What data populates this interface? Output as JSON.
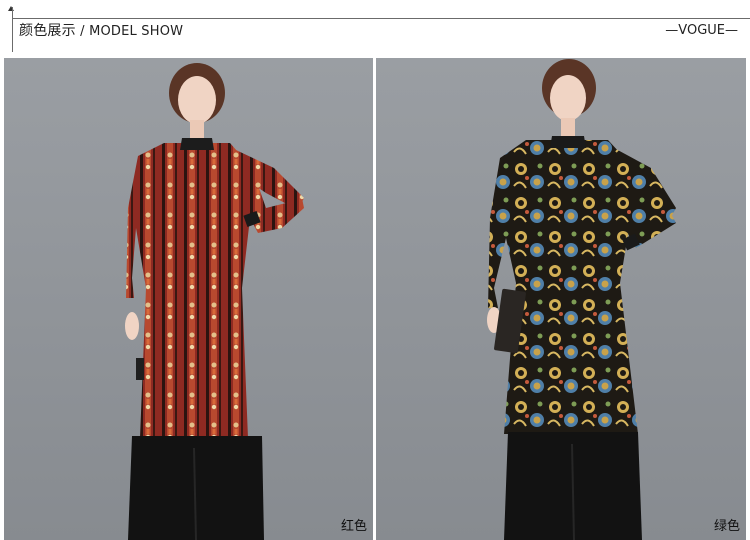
{
  "header": {
    "title_cn": "颜色展示",
    "separator": " / ",
    "title_en": "MODEL SHOW",
    "brand": "—VOGUE—"
  },
  "photos": [
    {
      "color_label": "红色",
      "colors": {
        "background": "#8f9398",
        "dress_main": "#8e2a22",
        "dress_accent": "#d9b37a",
        "pants": "#121212",
        "skin": "#f0d4c4",
        "hair": "#5a3526"
      }
    },
    {
      "color_label": "绿色",
      "colors": {
        "background": "#8f9398",
        "dress_main": "#1e1a14",
        "dress_accent": "#d3b056",
        "dress_accent2": "#4f7fa8",
        "pants": "#121212",
        "skin": "#f0d4c4",
        "hair": "#5a3526"
      }
    }
  ]
}
